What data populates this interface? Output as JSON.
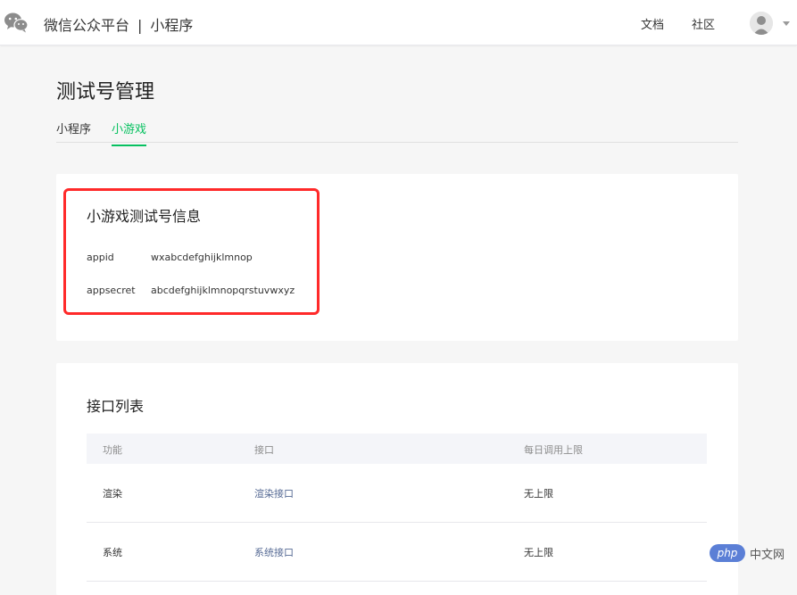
{
  "header": {
    "platform": "微信公众平台",
    "separator": "|",
    "product": "小程序",
    "links": [
      "文档",
      "社区"
    ]
  },
  "page": {
    "title": "测试号管理",
    "tabs": [
      {
        "label": "小程序",
        "active": false
      },
      {
        "label": "小游戏",
        "active": true
      }
    ]
  },
  "info": {
    "title": "小游戏测试号信息",
    "rows": [
      {
        "key": "appid",
        "value": "wxabcdefghijklmnop"
      },
      {
        "key": "appsecret",
        "value": "abcdefghijklmnopqrstuvwxyz"
      }
    ]
  },
  "api": {
    "title": "接口列表",
    "columns": [
      "功能",
      "接口",
      "每日调用上限"
    ],
    "rows": [
      {
        "feature": "渲染",
        "api": "渲染接口",
        "limit": "无上限"
      },
      {
        "feature": "系统",
        "api": "系统接口",
        "limit": "无上限"
      }
    ]
  },
  "watermark": {
    "badge": "php",
    "text": "中文网"
  },
  "colors": {
    "accent": "#07c160",
    "link": "#576b95",
    "highlight": "#ff2a2a"
  }
}
